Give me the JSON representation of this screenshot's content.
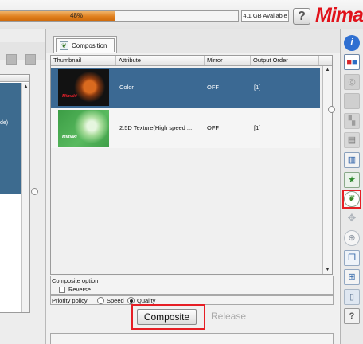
{
  "topbar": {
    "progress_percent": 48,
    "progress_label": "48%",
    "storage_label": "4.1 GB Available",
    "help_label": "?",
    "brand_text": "Mimaki"
  },
  "left_panel": {
    "selected_item_fragment": "de)"
  },
  "tabs": [
    {
      "label": "Composition",
      "icon": "composition-icon",
      "selected": true
    }
  ],
  "table": {
    "columns": [
      "Thumbnail",
      "Attribute",
      "Mirror",
      "Output Order"
    ],
    "rows": [
      {
        "thumbnail": "tiger-color-thumbnail",
        "thumbnail_brand": "Mimaki",
        "attribute": "Color",
        "mirror": "OFF",
        "output_order": "[1]",
        "selected": true
      },
      {
        "thumbnail": "tiger-texture-thumbnail",
        "thumbnail_brand": "Mimaki",
        "attribute": "2.5D Texture(High speed ...",
        "mirror": "OFF",
        "output_order": "[1]",
        "selected": false
      }
    ]
  },
  "composite_option": {
    "title": "Composite option",
    "reverse_label": "Reverse",
    "reverse_checked": false
  },
  "priority_policy": {
    "label": "Priority policy",
    "options": [
      {
        "label": "Speed",
        "selected": false
      },
      {
        "label": "Quality",
        "selected": true
      }
    ]
  },
  "actions": {
    "composite_label": "Composite",
    "release_label": "Release",
    "release_enabled": false
  },
  "toolbar": {
    "items": [
      {
        "icon": "info-icon"
      },
      {
        "icon": "layers-icon"
      },
      {
        "icon": "disabled-target-icon"
      },
      {
        "icon": "disabled-square-icon"
      },
      {
        "icon": "disabled-move-icon"
      },
      {
        "icon": "spreadsheet-icon"
      },
      {
        "icon": "print-job-icon"
      },
      {
        "icon": "star-layers-icon"
      },
      {
        "icon": "composition-icon",
        "highlighted": true
      },
      {
        "icon": "arrows-icon"
      },
      {
        "icon": "crosshair-icon"
      },
      {
        "icon": "copy-icon"
      },
      {
        "icon": "split-icon"
      },
      {
        "icon": "trash-icon"
      },
      {
        "icon": "help-document-icon"
      }
    ]
  },
  "colors": {
    "brand_red": "#e61e25",
    "selection_blue": "#3b6993",
    "progress_orange": "#e0801e"
  }
}
